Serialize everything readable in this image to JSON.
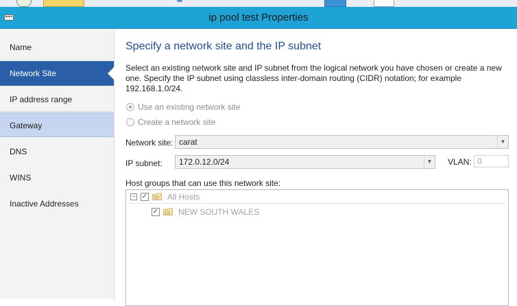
{
  "window": {
    "title": "ip pool test Properties"
  },
  "sidebar": {
    "items": [
      {
        "label": "Name"
      },
      {
        "label": "Network Site"
      },
      {
        "label": "IP address range"
      },
      {
        "label": "Gateway"
      },
      {
        "label": "DNS"
      },
      {
        "label": "WINS"
      },
      {
        "label": "Inactive Addresses"
      }
    ]
  },
  "page": {
    "heading": "Specify a network site and the IP subnet",
    "description": "Select an existing network site and IP subnet from the logical network you have chosen or create a new one. Specify the IP subnet using classless inter-domain routing (CIDR) notation; for example 192.168.1.0/24.",
    "options": [
      {
        "label": "Use an existing network site",
        "checked": true
      },
      {
        "label": "Create a network site",
        "checked": false
      }
    ],
    "network_site": {
      "label": "Network site:",
      "value": "carat"
    },
    "ip_subnet": {
      "label": "IP subnet:",
      "value": "172.0.12.0/24"
    },
    "vlan": {
      "label": "VLAN:",
      "value": "0"
    },
    "host_groups": {
      "label": "Host groups that can use this network site:",
      "tree": [
        {
          "label": "All Hosts",
          "checked": true,
          "expanded": true
        },
        {
          "label": "NEW SOUTH WALES",
          "checked": true
        }
      ]
    }
  },
  "colors": {
    "titlebar": "#1ea3d6",
    "selected_nav": "#2a5fa8",
    "hover_nav": "#c6d6f0",
    "heading": "#1f4e8c"
  }
}
